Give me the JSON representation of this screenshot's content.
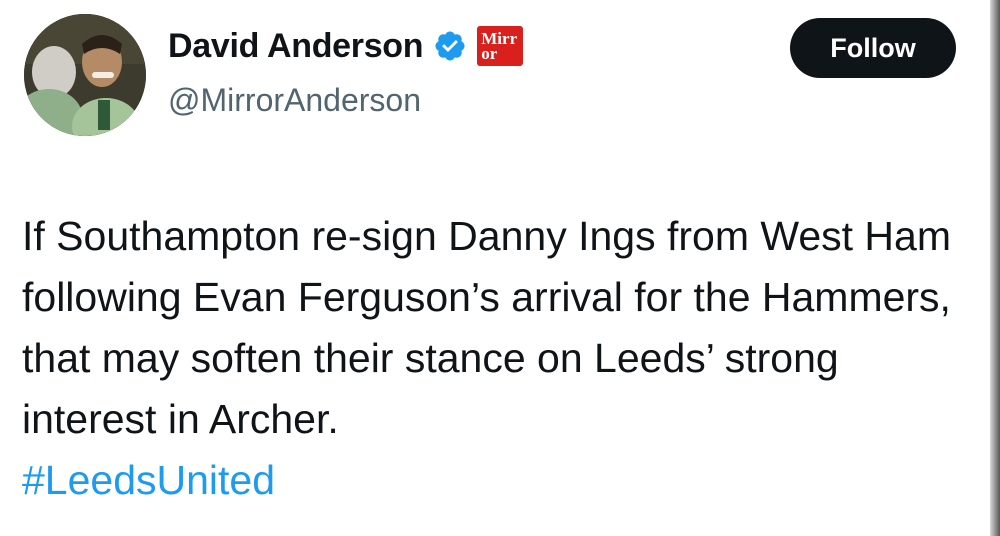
{
  "author": {
    "name": "David Anderson",
    "handle": "@MirrorAnderson",
    "verified_icon": "verified-badge-icon",
    "affiliation_badge": {
      "line1": "Mirr",
      "line2": "or",
      "color": "#d9201c"
    }
  },
  "follow_button": {
    "label": "Follow"
  },
  "tweet": {
    "text": "If Southampton re-sign Danny Ings from West Ham following Evan Ferguson’s arrival for the Hammers, that may soften their stance on Leeds’ strong interest in Archer.",
    "hashtag": "#LeedsUnited"
  },
  "colors": {
    "text": "#0f1419",
    "secondary_text": "#536471",
    "link": "#1d9bf0",
    "verified": "#1d9bf0",
    "button_bg": "#0f1419"
  }
}
